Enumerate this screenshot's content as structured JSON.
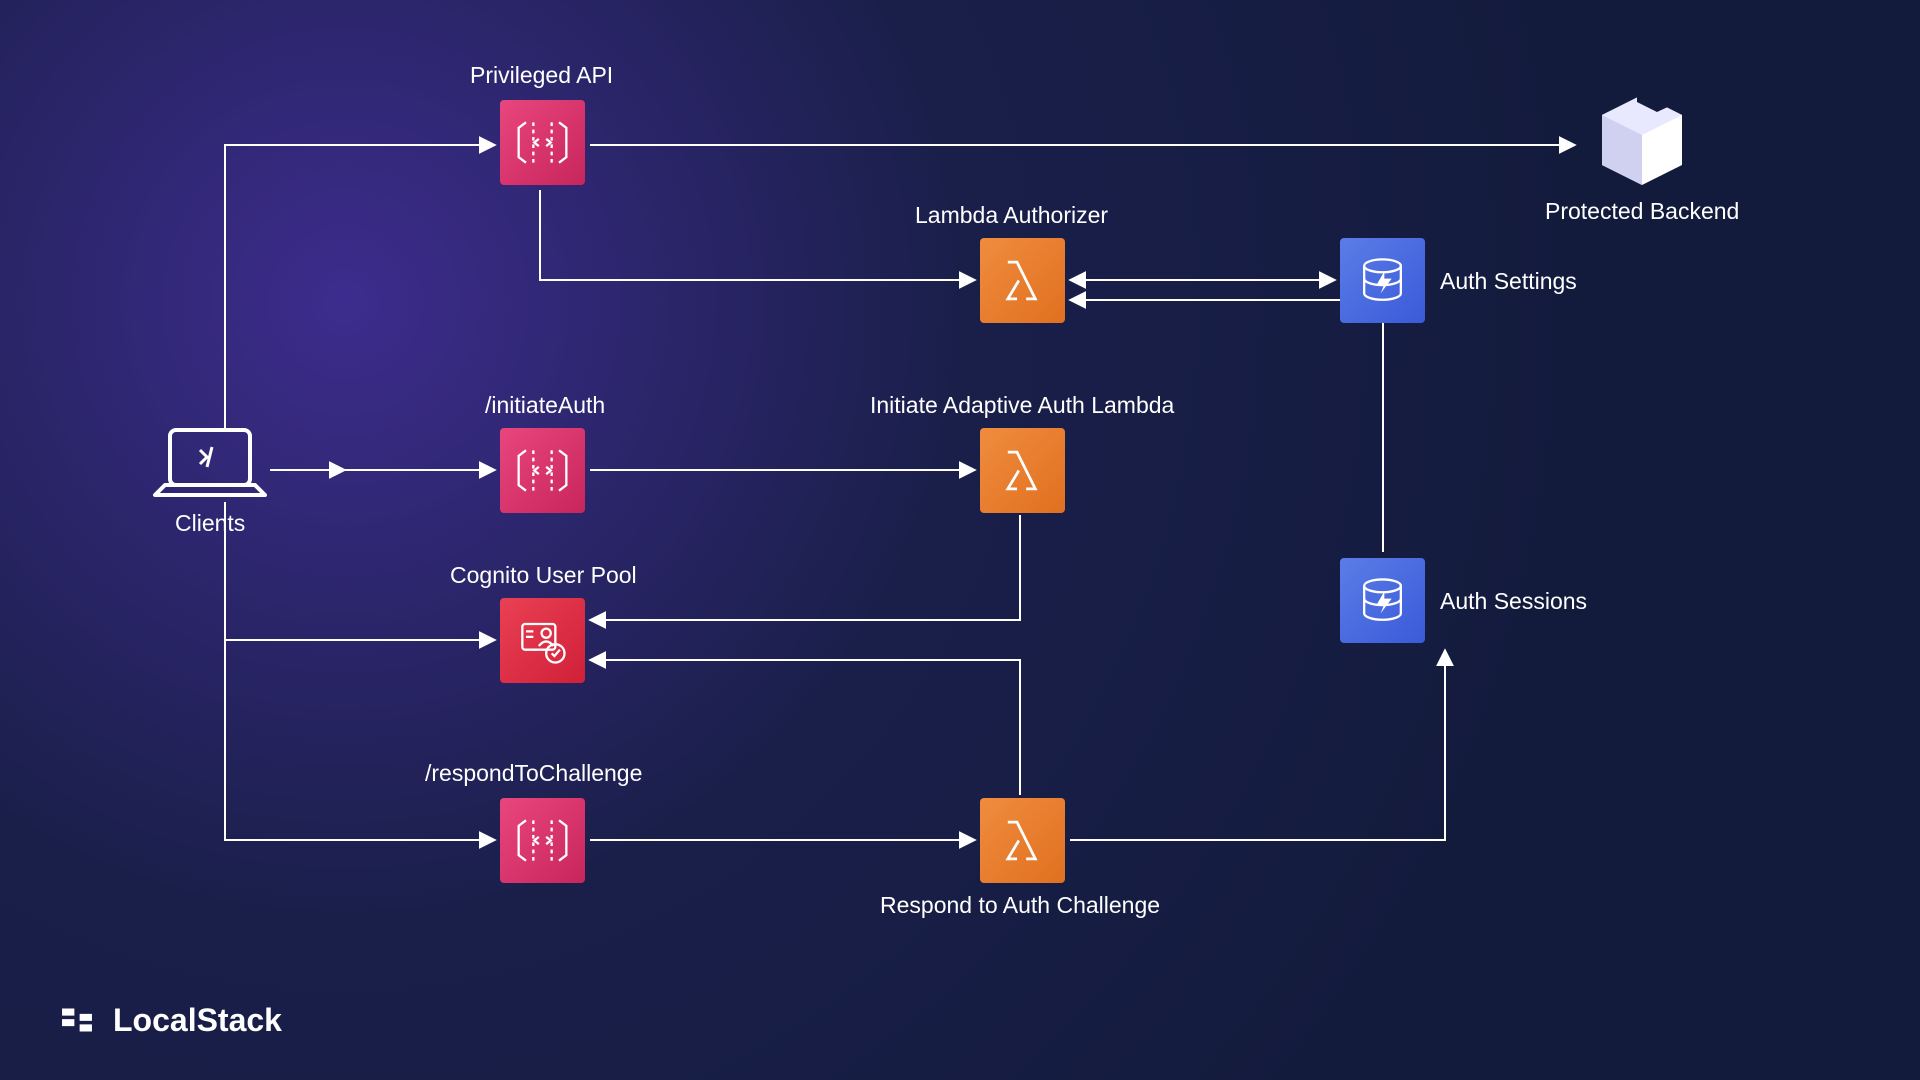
{
  "nodes": {
    "clients": "Clients",
    "privileged_api": "Privileged API",
    "initiate_auth": "/initiateAuth",
    "cognito": "Cognito User Pool",
    "respond_challenge": "/respondToChallenge",
    "lambda_authorizer": "Lambda Authorizer",
    "initiate_lambda": "Initiate Adaptive Auth Lambda",
    "respond_lambda": "Respond to Auth Challenge",
    "auth_settings": "Auth Settings",
    "auth_sessions": "Auth Sessions",
    "backend": "Protected Backend"
  },
  "logo": "LocalStack"
}
